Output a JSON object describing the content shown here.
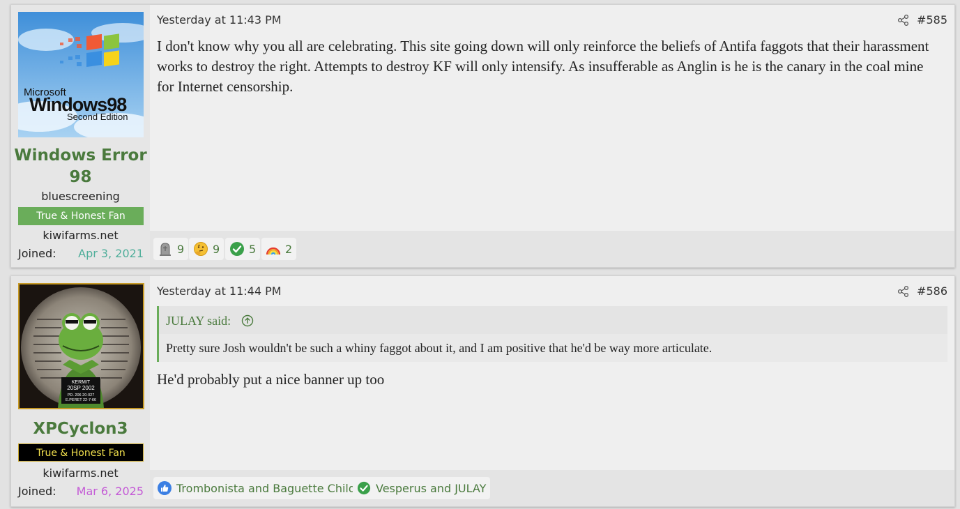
{
  "posts": [
    {
      "username": "Windows Error 98",
      "user_title": "bluescreening",
      "banner": "True & Honest Fan",
      "site": "kiwifarms.net",
      "joined_label": "Joined:",
      "joined_date": "Apr 3, 2021",
      "joined_color": "#4fae9a",
      "avatar_text": {
        "brand": "Microsoft",
        "product": "Windows98",
        "edition": "Second Edition"
      },
      "time": "Yesterday at 11:43 PM",
      "post_number": "#585",
      "body": "I don't know why you all are celebrating. This site going down will only reinforce the beliefs of Antifa faggots that their harassment works to destroy the right. Attempts to destroy KF will only intensify. As insufferable as Anglin is he is the canary in the coal mine for Internet censorship.",
      "reactions": [
        {
          "icon": "tombstone-icon",
          "count": "9"
        },
        {
          "icon": "thinking-face-icon",
          "count": "9"
        },
        {
          "icon": "green-check-icon",
          "count": "5"
        },
        {
          "icon": "rainbow-icon",
          "count": "2"
        }
      ]
    },
    {
      "username": "XPCyclon3",
      "banner": "True & Honest Fan",
      "site": "kiwifarms.net",
      "joined_label": "Joined:",
      "joined_date": "Mar 6, 2025",
      "joined_color": "#c45ad6",
      "avatar_text": {
        "line1": "KERMIT",
        "line2": "20SP 2002",
        "line3": "PD. 206  20-027",
        "line4": "E.PERET  22-7-66"
      },
      "time": "Yesterday at 11:44 PM",
      "post_number": "#586",
      "quote": {
        "author": "JULAY said:",
        "text": "Pretty sure Josh wouldn't be such a whiny faggot about it, and I am positive that he'd be way more articulate."
      },
      "body": "He'd probably put a nice banner up too",
      "reactions": [
        {
          "icon": "thumbs-up-icon",
          "users": "Trombonista and Baguette Child"
        },
        {
          "icon": "green-check-icon",
          "users": "Vesperus and JULAY"
        }
      ]
    }
  ],
  "colors": {
    "username": "#4a7a3d",
    "banner_green": "#6aad5a",
    "banner_black_text": "#f2e04d",
    "quote_border": "#6aad5a"
  }
}
